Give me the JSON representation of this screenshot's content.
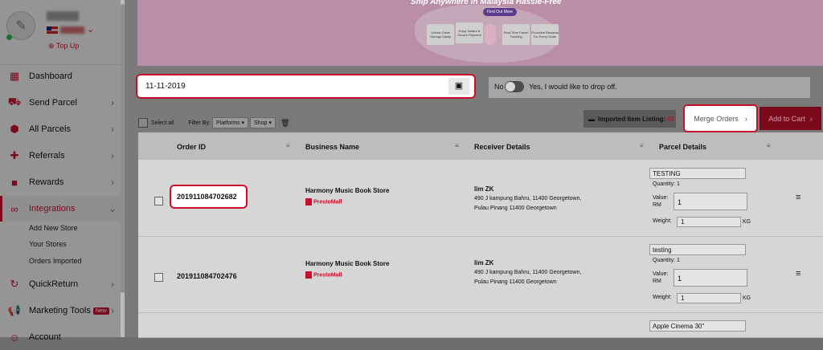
{
  "sidebar": {
    "topup_label": "Top Up",
    "items": [
      {
        "label": "Dashboard",
        "icon": "dashboard-icon"
      },
      {
        "label": "Send Parcel",
        "icon": "truck-icon"
      },
      {
        "label": "All Parcels",
        "icon": "parcels-icon"
      },
      {
        "label": "Referrals",
        "icon": "add-user-icon"
      },
      {
        "label": "Rewards",
        "icon": "gift-icon"
      },
      {
        "label": "Integrations",
        "icon": "link-icon"
      },
      {
        "label": "QuickReturn",
        "icon": "return-icon"
      },
      {
        "label": "Marketing Tools",
        "icon": "megaphone-icon",
        "badge": "New"
      },
      {
        "label": "Account",
        "icon": "account-icon"
      }
    ],
    "sub_items": [
      "Add New Store",
      "Your Stores",
      "Orders Imported"
    ]
  },
  "banner": {
    "title": "Ship Anywhere in Malaysia Hassle-Free",
    "button": "Find Out More",
    "features": [
      "Unlock Great Savings Easily",
      "Enjoy Instant & Secure Payment",
      "Real-Time Parcel Tracking",
      "Exclusive Rewards For Every Order"
    ]
  },
  "date": {
    "value": "11-11-2019"
  },
  "dropoff": {
    "no_label": "No",
    "yes_label": "Yes, I would like to drop off."
  },
  "imported": {
    "label": "Imported Item Listing:",
    "count": "46"
  },
  "buttons": {
    "merge": "Merge Orders",
    "cart": "Add to Cart"
  },
  "filters": {
    "select_all": "Select all",
    "filter_by": "Filter By:",
    "platforms": "Platforms",
    "shop": "Shop"
  },
  "table": {
    "headers": [
      "Order ID",
      "Business Name",
      "Receiver Details",
      "Parcel Details"
    ],
    "labels": {
      "quantity": "Quantity: 1",
      "value": "Value:",
      "rm": "RM",
      "weight": "Weight:",
      "kg": "KG"
    },
    "rows": [
      {
        "order_id": "201911084702682",
        "business": "Harmony Music Book Store",
        "platform": "PrestoMall",
        "receiver": "lim ZK",
        "addr1": "490 J kampung Bahru, 11400 Georgetown,",
        "addr2": "Pulau Pinang 11400 Georgetown",
        "item": "TESTING",
        "value": "1",
        "weight": "1"
      },
      {
        "order_id": "201911084702476",
        "business": "Harmony Music Book Store",
        "platform": "PrestoMall",
        "receiver": "lim ZK",
        "addr1": "490 J kampung Bahru, 11400 Georgetown,",
        "addr2": "Pulau Pinang 11400 Georgetown",
        "item": "testing",
        "value": "1",
        "weight": "1"
      },
      {
        "item": "Apple Cinema 30\""
      }
    ]
  }
}
